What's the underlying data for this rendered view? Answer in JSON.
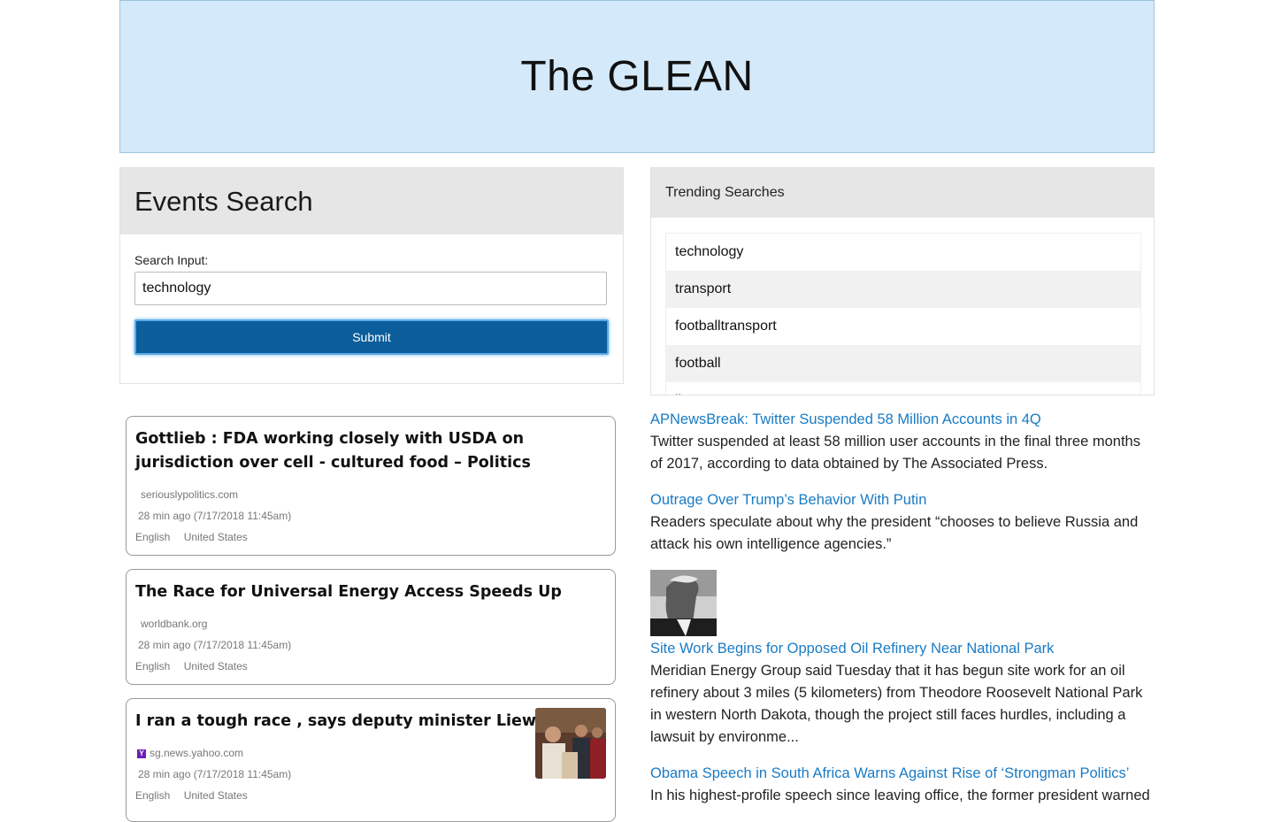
{
  "header": {
    "title": "The GLEAN"
  },
  "search": {
    "heading": "Events Search",
    "label": "Search Input:",
    "value": "technology",
    "submit_label": "Submit"
  },
  "events": [
    {
      "title": "Gottlieb : FDA working closely with USDA on jurisdiction over cell - cultured food – Politics",
      "source": "seriouslypolitics.com",
      "time": "28 min ago (7/17/2018 11:45am)",
      "language": "English",
      "country": "United States"
    },
    {
      "title": "The Race for Universal Energy Access Speeds Up",
      "source": "worldbank.org",
      "time": "28 min ago (7/17/2018 11:45am)",
      "language": "English",
      "country": "United States"
    },
    {
      "title": "I ran a tough race , says deputy minister Liew",
      "source": "sg.news.yahoo.com",
      "time": "28 min ago (7/17/2018 11:45am)",
      "language": "English",
      "country": "United States"
    }
  ],
  "trending": {
    "heading": "Trending Searches",
    "items": [
      "technology",
      "transport",
      "footballtransport",
      "football",
      "ibm"
    ]
  },
  "news": [
    {
      "title": "APNewsBreak: Twitter Suspended 58 Million Accounts in 4Q",
      "desc": "Twitter suspended at least 58 million user accounts in the final three months of 2017, according to data obtained by The Associated Press."
    },
    {
      "title": "Outrage Over Trump’s Behavior With Putin",
      "desc": "Readers speculate about why the president “chooses to believe Russia and attack his own intelligence agencies.”"
    },
    {
      "title": "Site Work Begins for Opposed Oil Refinery Near National Park",
      "desc": "Meridian Energy Group said Tuesday that it has begun site work for an oil refinery about 3 miles (5 kilometers) from Theodore Roosevelt National Park in western North Dakota, though the project still faces hurdles, including a lawsuit by environme..."
    },
    {
      "title": "Obama Speech in South Africa Warns Against Rise of ‘Strongman Politics’",
      "desc": "In his highest-profile speech since leaving office, the former president warned"
    }
  ],
  "colors": {
    "header_bg": "#d4e9f9",
    "submit_bg": "#0b5d9b",
    "link": "#1a7bc4"
  }
}
